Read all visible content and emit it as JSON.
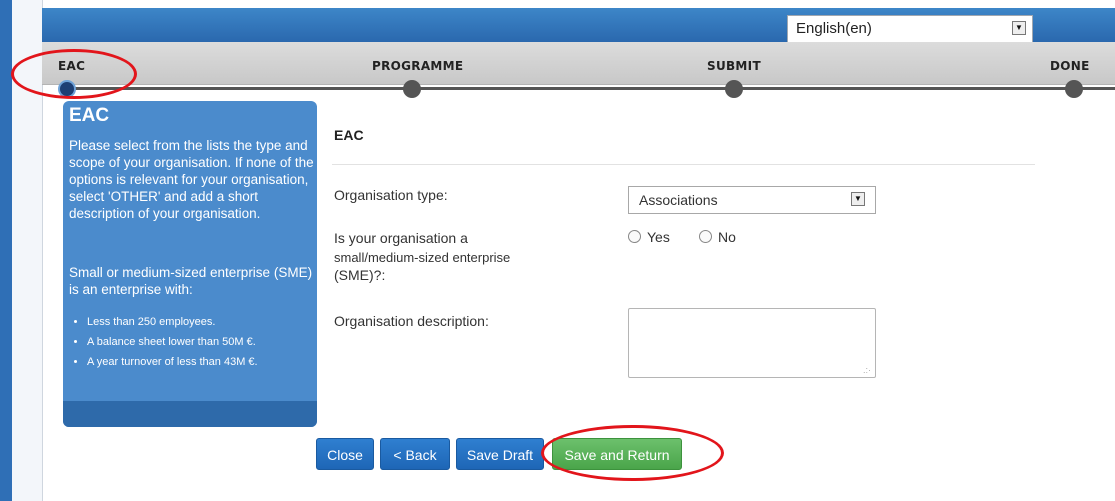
{
  "language_select": {
    "value": "English(en)"
  },
  "steps": [
    {
      "label": "EAC",
      "active": true
    },
    {
      "label": "PROGRAMME",
      "active": false
    },
    {
      "label": "SUBMIT",
      "active": false
    },
    {
      "label": "DONE",
      "active": false
    }
  ],
  "sidebar": {
    "title": "EAC",
    "paragraph1": "Please select from the lists the type and scope of your organisation. If none of the options is relevant for your organisation, select 'OTHER' and add a short description of your organisation.",
    "paragraph2": "Small or medium-sized enterprise (SME) is an enterprise with:",
    "bullets": [
      "Less than 250 employees.",
      "A balance sheet lower than 50M €.",
      "A year turnover of less than 43M €."
    ]
  },
  "form": {
    "title": "EAC",
    "organisation_type": {
      "label": "Organisation type:",
      "value": "Associations"
    },
    "sme": {
      "label_line1": "Is your organisation a",
      "label_line2": "small/medium-sized enterprise",
      "label_line3": "(SME)?:",
      "option_yes": "Yes",
      "option_no": "No"
    },
    "description": {
      "label": "Organisation description:",
      "value": ""
    }
  },
  "buttons": {
    "close": "Close",
    "back": "< Back",
    "save_draft": "Save Draft",
    "save_and_return": "Save and Return"
  },
  "colors": {
    "header_blue": "#2a68ae",
    "sidebar_blue": "#4b8bcc",
    "button_blue": "#1e66b6",
    "button_green": "#4aa54a",
    "highlight_red": "#e2151b"
  }
}
